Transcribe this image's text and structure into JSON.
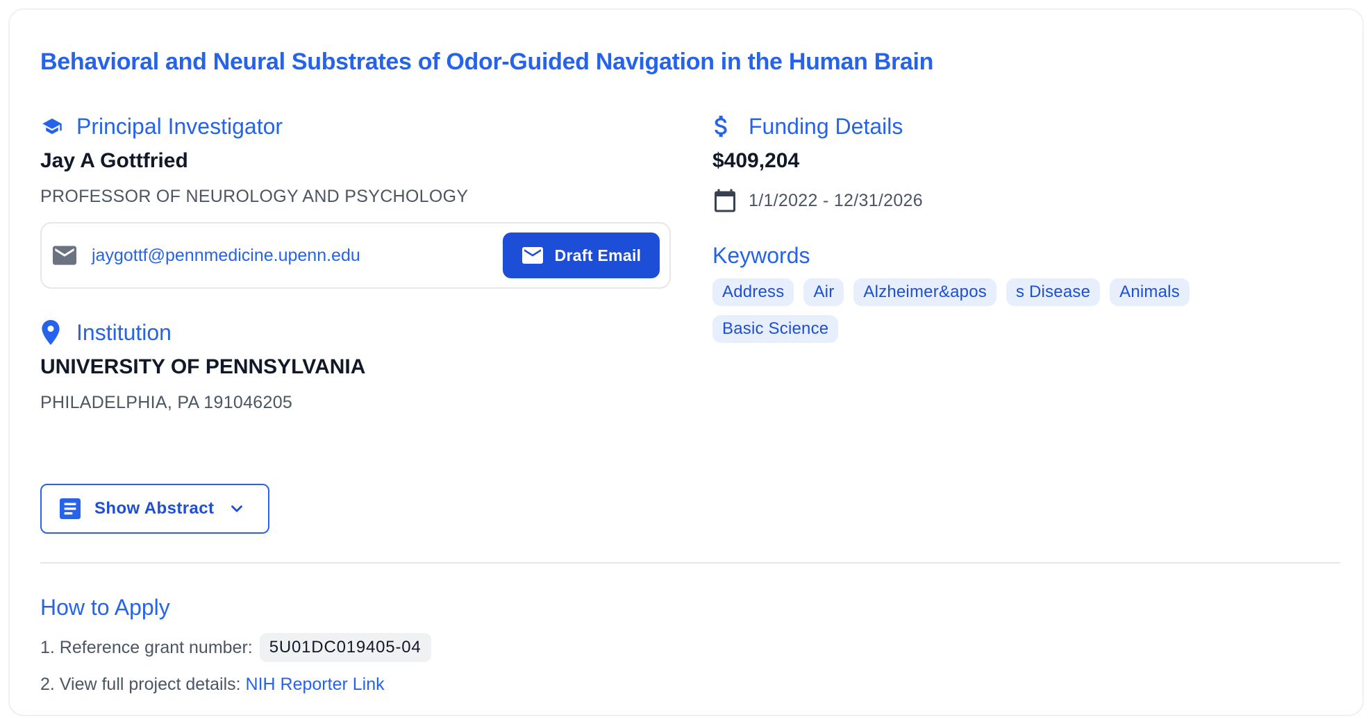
{
  "grant": {
    "title": "Behavioral and Neural Substrates of Odor-Guided Navigation in the Human Brain"
  },
  "pi": {
    "heading": "Principal Investigator",
    "name": "Jay A Gottfried",
    "position": "PROFESSOR OF NEUROLOGY AND PSYCHOLOGY",
    "email": "jaygottf@pennmedicine.upenn.edu",
    "draft_email_label": "Draft Email"
  },
  "institution": {
    "heading": "Institution",
    "name": "UNIVERSITY OF PENNSYLVANIA",
    "location": "PHILADELPHIA, PA 191046205"
  },
  "funding": {
    "heading": "Funding Details",
    "amount": "$409,204",
    "date_range": "1/1/2022 - 12/31/2026"
  },
  "keywords": {
    "heading": "Keywords",
    "items": [
      "Address",
      "Air",
      "Alzheimer&apos",
      "s Disease",
      "Animals",
      "Basic Science"
    ]
  },
  "abstract": {
    "toggle_label": "Show Abstract"
  },
  "apply": {
    "heading": "How to Apply",
    "step1_label": "1. Reference grant number:",
    "grant_number": "5U01DC019405-04",
    "step2_label": "2. View full project details:",
    "reporter_link": "NIH Reporter Link"
  },
  "colors": {
    "accent": "#2563eb",
    "button": "#1d4ed8",
    "keyword_bg": "#e8effc"
  }
}
